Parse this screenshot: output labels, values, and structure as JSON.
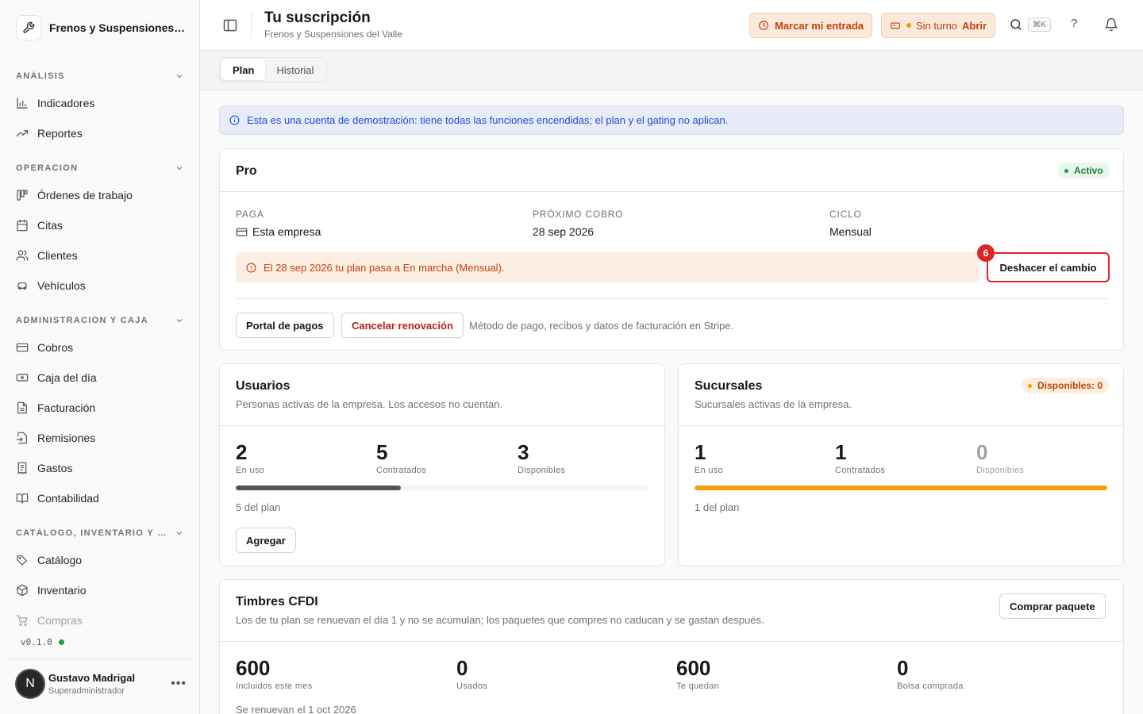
{
  "brand": {
    "name": "Frenos y Suspensiones del Valle"
  },
  "sidebar": {
    "sections": [
      {
        "label": "ANÁLISIS",
        "items": [
          {
            "label": "Indicadores",
            "icon": "bar-chart-icon"
          },
          {
            "label": "Reportes",
            "icon": "trending-up-icon"
          }
        ]
      },
      {
        "label": "OPERACIÓN",
        "items": [
          {
            "label": "Órdenes de trabajo",
            "icon": "kanban-icon"
          },
          {
            "label": "Citas",
            "icon": "calendar-icon"
          },
          {
            "label": "Clientes",
            "icon": "users-icon"
          },
          {
            "label": "Vehículos",
            "icon": "car-icon"
          }
        ]
      },
      {
        "label": "ADMINISTRACIÓN Y CAJA",
        "items": [
          {
            "label": "Cobros",
            "icon": "credit-card-icon"
          },
          {
            "label": "Caja del día",
            "icon": "banknote-icon"
          },
          {
            "label": "Facturación",
            "icon": "file-text-icon"
          },
          {
            "label": "Remisiones",
            "icon": "file-output-icon"
          },
          {
            "label": "Gastos",
            "icon": "receipt-icon"
          },
          {
            "label": "Contabilidad",
            "icon": "book-open-icon"
          }
        ]
      },
      {
        "label": "CATÁLOGO, INVENTARIO Y COMPRAS",
        "items": [
          {
            "label": "Catálogo",
            "icon": "tags-icon"
          },
          {
            "label": "Inventario",
            "icon": "package-icon"
          },
          {
            "label": "Compras",
            "icon": "shopping-cart-icon"
          }
        ]
      }
    ],
    "version": "v0.1.0",
    "user": {
      "initial": "N",
      "name": "Gustavo Madrigal",
      "role": "Superadministrador",
      "more": "•••"
    }
  },
  "header": {
    "title": "Tu suscripción",
    "subtitle": "Frenos y Suspensiones del Valle",
    "clock_in": "Marcar mi entrada",
    "shift_status": "Sin turno",
    "shift_open": "Abrir",
    "shortcut": "⌘K",
    "help": "?"
  },
  "tabs": [
    {
      "label": "Plan",
      "active": true
    },
    {
      "label": "Historial",
      "active": false
    }
  ],
  "demo_notice": "Esta es una cuenta de demostración: tiene todas las funciones encendidas; el plan y el gating no aplican.",
  "plan": {
    "name": "Pro",
    "status": "Activo",
    "payer_label": "PAGA",
    "payer_value": "Esta empresa",
    "next_charge_label": "PRÓXIMO COBRO",
    "next_charge_value": "28 sep 2026",
    "cycle_label": "CICLO",
    "cycle_value": "Mensual",
    "change_notice": "El 28 sep 2026 tu plan pasa a En marcha (Mensual).",
    "undo_button": "Deshacer el cambio",
    "step_number": "6",
    "portal_button": "Portal de pagos",
    "cancel_button": "Cancelar renovación",
    "stripe_note": "Método de pago, recibos y datos de facturación en Stripe."
  },
  "users": {
    "title": "Usuarios",
    "description": "Personas activas de la empresa. Los accesos no cuentan.",
    "in_use": "2",
    "in_use_label": "En uso",
    "contracted": "5",
    "contracted_label": "Contratados",
    "available": "3",
    "available_label": "Disponibles",
    "usage_fraction": 0.4,
    "plan_note": "5 del plan",
    "add_button": "Agregar",
    "bar_color": "#52525b"
  },
  "branches": {
    "title": "Sucursales",
    "description": "Sucursales activas de la empresa.",
    "badge": "Disponibles: 0",
    "in_use": "1",
    "in_use_label": "En uso",
    "contracted": "1",
    "contracted_label": "Contratados",
    "available": "0",
    "available_label": "Disponibles",
    "usage_fraction": 1.0,
    "plan_note": "1 del plan",
    "bar_color": "#f59e0b"
  },
  "stamps": {
    "title": "Timbres CFDI",
    "description": "Los de tu plan se renuevan el día 1 y no se acumulan; los paquetes que compres no caducan y se gastan después.",
    "buy_button": "Comprar paquete",
    "included": "600",
    "included_label": "Incluidos este mes",
    "used": "0",
    "used_label": "Usados",
    "remaining": "600",
    "remaining_label": "Te quedan",
    "purchased": "0",
    "purchased_label": "Bolsa comprada",
    "renew_note": "Se renuevan el 1 oct 2026"
  }
}
